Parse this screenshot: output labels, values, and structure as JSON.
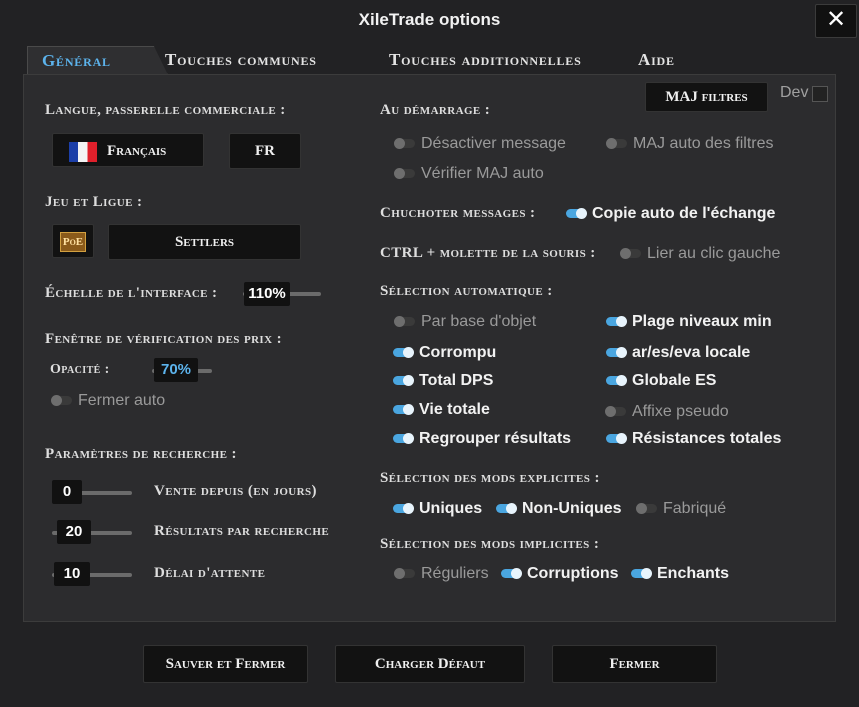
{
  "window": {
    "title": "XileTrade options"
  },
  "tabs": [
    "Général",
    "Touches communes",
    "Touches additionnelles",
    "Aide"
  ],
  "header": {
    "maj_filtres": "MAJ filtres",
    "dev_label": "Dev"
  },
  "general": {
    "langue_title": "Langue, passerelle commerciale :",
    "langue_value": "Français",
    "gateway_value": "FR",
    "jeu_title": "Jeu et Ligue :",
    "game_icon": "PoE",
    "league_value": "Settlers",
    "echelle_label": "Échelle de l'interface :",
    "echelle_value": "110%",
    "echelle_level": 0.5,
    "fenetre_title": "Fenêtre de vérification des prix :",
    "opacite_label": "Opacité :",
    "opacite_value": "70%",
    "fermer_auto": "Fermer auto",
    "params_title": "Paramètres de recherche :",
    "vente_value": "0",
    "vente_label": "Vente depuis (en jours)",
    "resultats_value": "20",
    "resultats_label": "Résultats par recherche",
    "delai_value": "10",
    "delai_label": "Délai d'attente"
  },
  "right": {
    "demarrage_title": "Au démarrage :",
    "desactiver_message": "Désactiver message",
    "maj_auto_filtres": "MAJ auto des filtres",
    "verifier_maj": "Vérifier MAJ auto",
    "chuchoter_title": "Chuchoter messages :",
    "copie_auto": "Copie auto de l'échange",
    "ctrl_title": "CTRL + molette de la souris :",
    "lier_clic": "Lier au clic gauche",
    "selection_auto_title": "Sélection automatique :",
    "par_base": "Par base d'objet",
    "plage_niveaux": "Plage niveaux min",
    "corrompu": "Corrompu",
    "ar_es_eva": "ar/es/eva locale",
    "total_dps": "Total DPS",
    "globale_es": "Globale ES",
    "vie_totale": "Vie totale",
    "affixe_pseudo": "Affixe pseudo",
    "regrouper": "Regrouper résultats",
    "resistances": "Résistances totales",
    "explicites_title": "Sélection des mods explicites :",
    "uniques": "Uniques",
    "non_uniques": "Non-Uniques",
    "fabrique": "Fabriqué",
    "implicites_title": "Sélection des mods implicites :",
    "reguliers": "Réguliers",
    "corruptions": "Corruptions",
    "enchants": "Enchants"
  },
  "footer": {
    "save": "Sauver et Fermer",
    "default": "Charger Défaut",
    "close": "Fermer"
  },
  "icons": {
    "close": "close-icon",
    "flag": "french-flag-icon",
    "game": "poe-logo-icon"
  }
}
